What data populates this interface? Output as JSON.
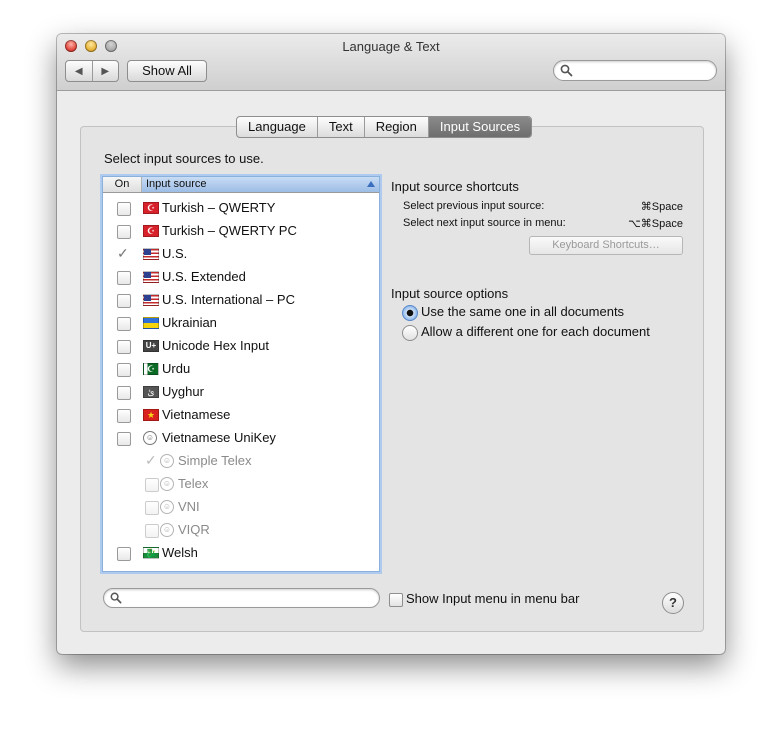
{
  "window": {
    "title": "Language & Text",
    "show_all": "Show All",
    "back_glyph": "◀",
    "forward_glyph": "▶"
  },
  "tabs": [
    {
      "label": "Language"
    },
    {
      "label": "Text"
    },
    {
      "label": "Region"
    },
    {
      "label": "Input Sources",
      "active": true
    }
  ],
  "instructions": "Select input sources to use.",
  "list": {
    "col_on": "On",
    "col_source": "Input source",
    "items": [
      {
        "label": "Turkish – QWERTY",
        "flag": "TR",
        "checked": false
      },
      {
        "label": "Turkish – QWERTY PC",
        "flag": "TR",
        "checked": false
      },
      {
        "label": "U.S.",
        "flag": "US",
        "checked": true
      },
      {
        "label": "U.S. Extended",
        "flag": "US",
        "checked": false
      },
      {
        "label": "U.S. International – PC",
        "flag": "US",
        "checked": false
      },
      {
        "label": "Ukrainian",
        "flag": "UA",
        "checked": false
      },
      {
        "label": "Unicode Hex Input",
        "flag": "U+",
        "checked": false
      },
      {
        "label": "Urdu",
        "flag": "PK",
        "checked": false
      },
      {
        "label": "Uyghur",
        "flag": "UG",
        "checked": false
      },
      {
        "label": "Vietnamese",
        "flag": "VN",
        "checked": false
      },
      {
        "label": "Vietnamese UniKey",
        "flag": "VK",
        "checked": false
      },
      {
        "label": "Simple Telex",
        "flag": "VK",
        "checked": true,
        "sub": true
      },
      {
        "label": "Telex",
        "flag": "VK",
        "checked": false,
        "sub": true
      },
      {
        "label": "VNI",
        "flag": "VK",
        "checked": false,
        "sub": true
      },
      {
        "label": "VIQR",
        "flag": "VK",
        "checked": false,
        "sub": true
      },
      {
        "label": "Welsh",
        "flag": "WL",
        "checked": false
      }
    ]
  },
  "shortcuts": {
    "heading": "Input source shortcuts",
    "prev_label": "Select previous input source:",
    "prev_key": "⌘Space",
    "next_label": "Select next input source in menu:",
    "next_key": "⌥⌘Space",
    "button": "Keyboard Shortcuts…"
  },
  "options": {
    "heading": "Input source options",
    "same": "Use the same one in all documents",
    "different": "Allow a different one for each document",
    "selected": "same"
  },
  "bottom": {
    "menu_label": "Show Input menu in menu bar",
    "help": "?"
  }
}
